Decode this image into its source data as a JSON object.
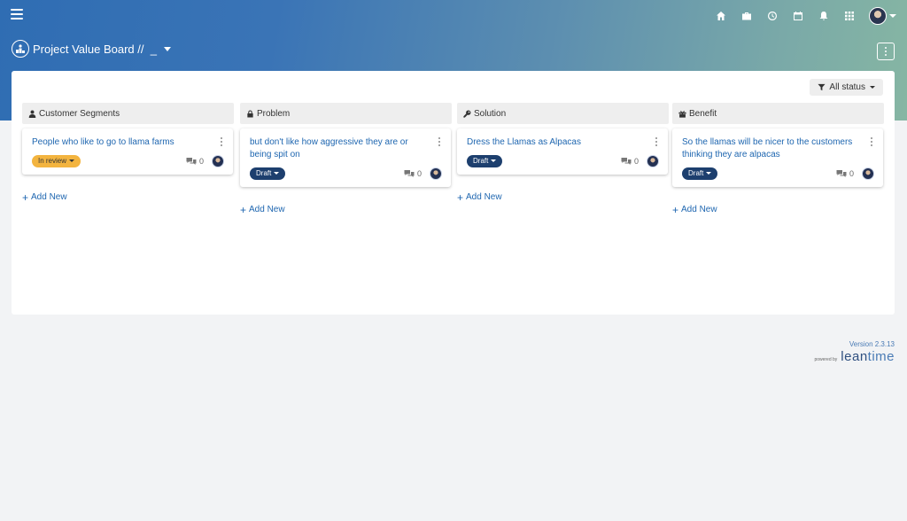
{
  "header": {
    "icons": [
      "home-icon",
      "briefcase-icon",
      "clock-icon",
      "calendar-icon",
      "bell-icon",
      "apps-grid-icon"
    ]
  },
  "board": {
    "title": "Project Value Board //  _"
  },
  "filter": {
    "label": "All status"
  },
  "columns": [
    {
      "title": "Customer Segments",
      "icon": "user-icon",
      "card": {
        "title": "People who like to go to llama farms",
        "status": "In review",
        "comments": "0"
      },
      "add_label": "Add New"
    },
    {
      "title": "Problem",
      "icon": "lock-icon",
      "card": {
        "title": "but don't like how aggressive they are or being spit on",
        "status": "Draft",
        "comments": "0"
      },
      "add_label": "Add New"
    },
    {
      "title": "Solution",
      "icon": "wrench-icon",
      "card": {
        "title": "Dress the Llamas as Alpacas",
        "status": "Draft",
        "comments": "0"
      },
      "add_label": "Add New"
    },
    {
      "title": "Benefit",
      "icon": "gift-icon",
      "card": {
        "title": "So the llamas will be nicer to the customers thinking they are alpacas",
        "status": "Draft",
        "comments": "0"
      },
      "add_label": "Add New"
    }
  ],
  "footer": {
    "version": "Version 2.3.13",
    "powered_by": "powered by",
    "logo_lean": "lean",
    "logo_time": "time"
  },
  "colors": {
    "accent": "#1e66b0",
    "review": "#f3b43f",
    "draft": "#1d3f6e"
  }
}
